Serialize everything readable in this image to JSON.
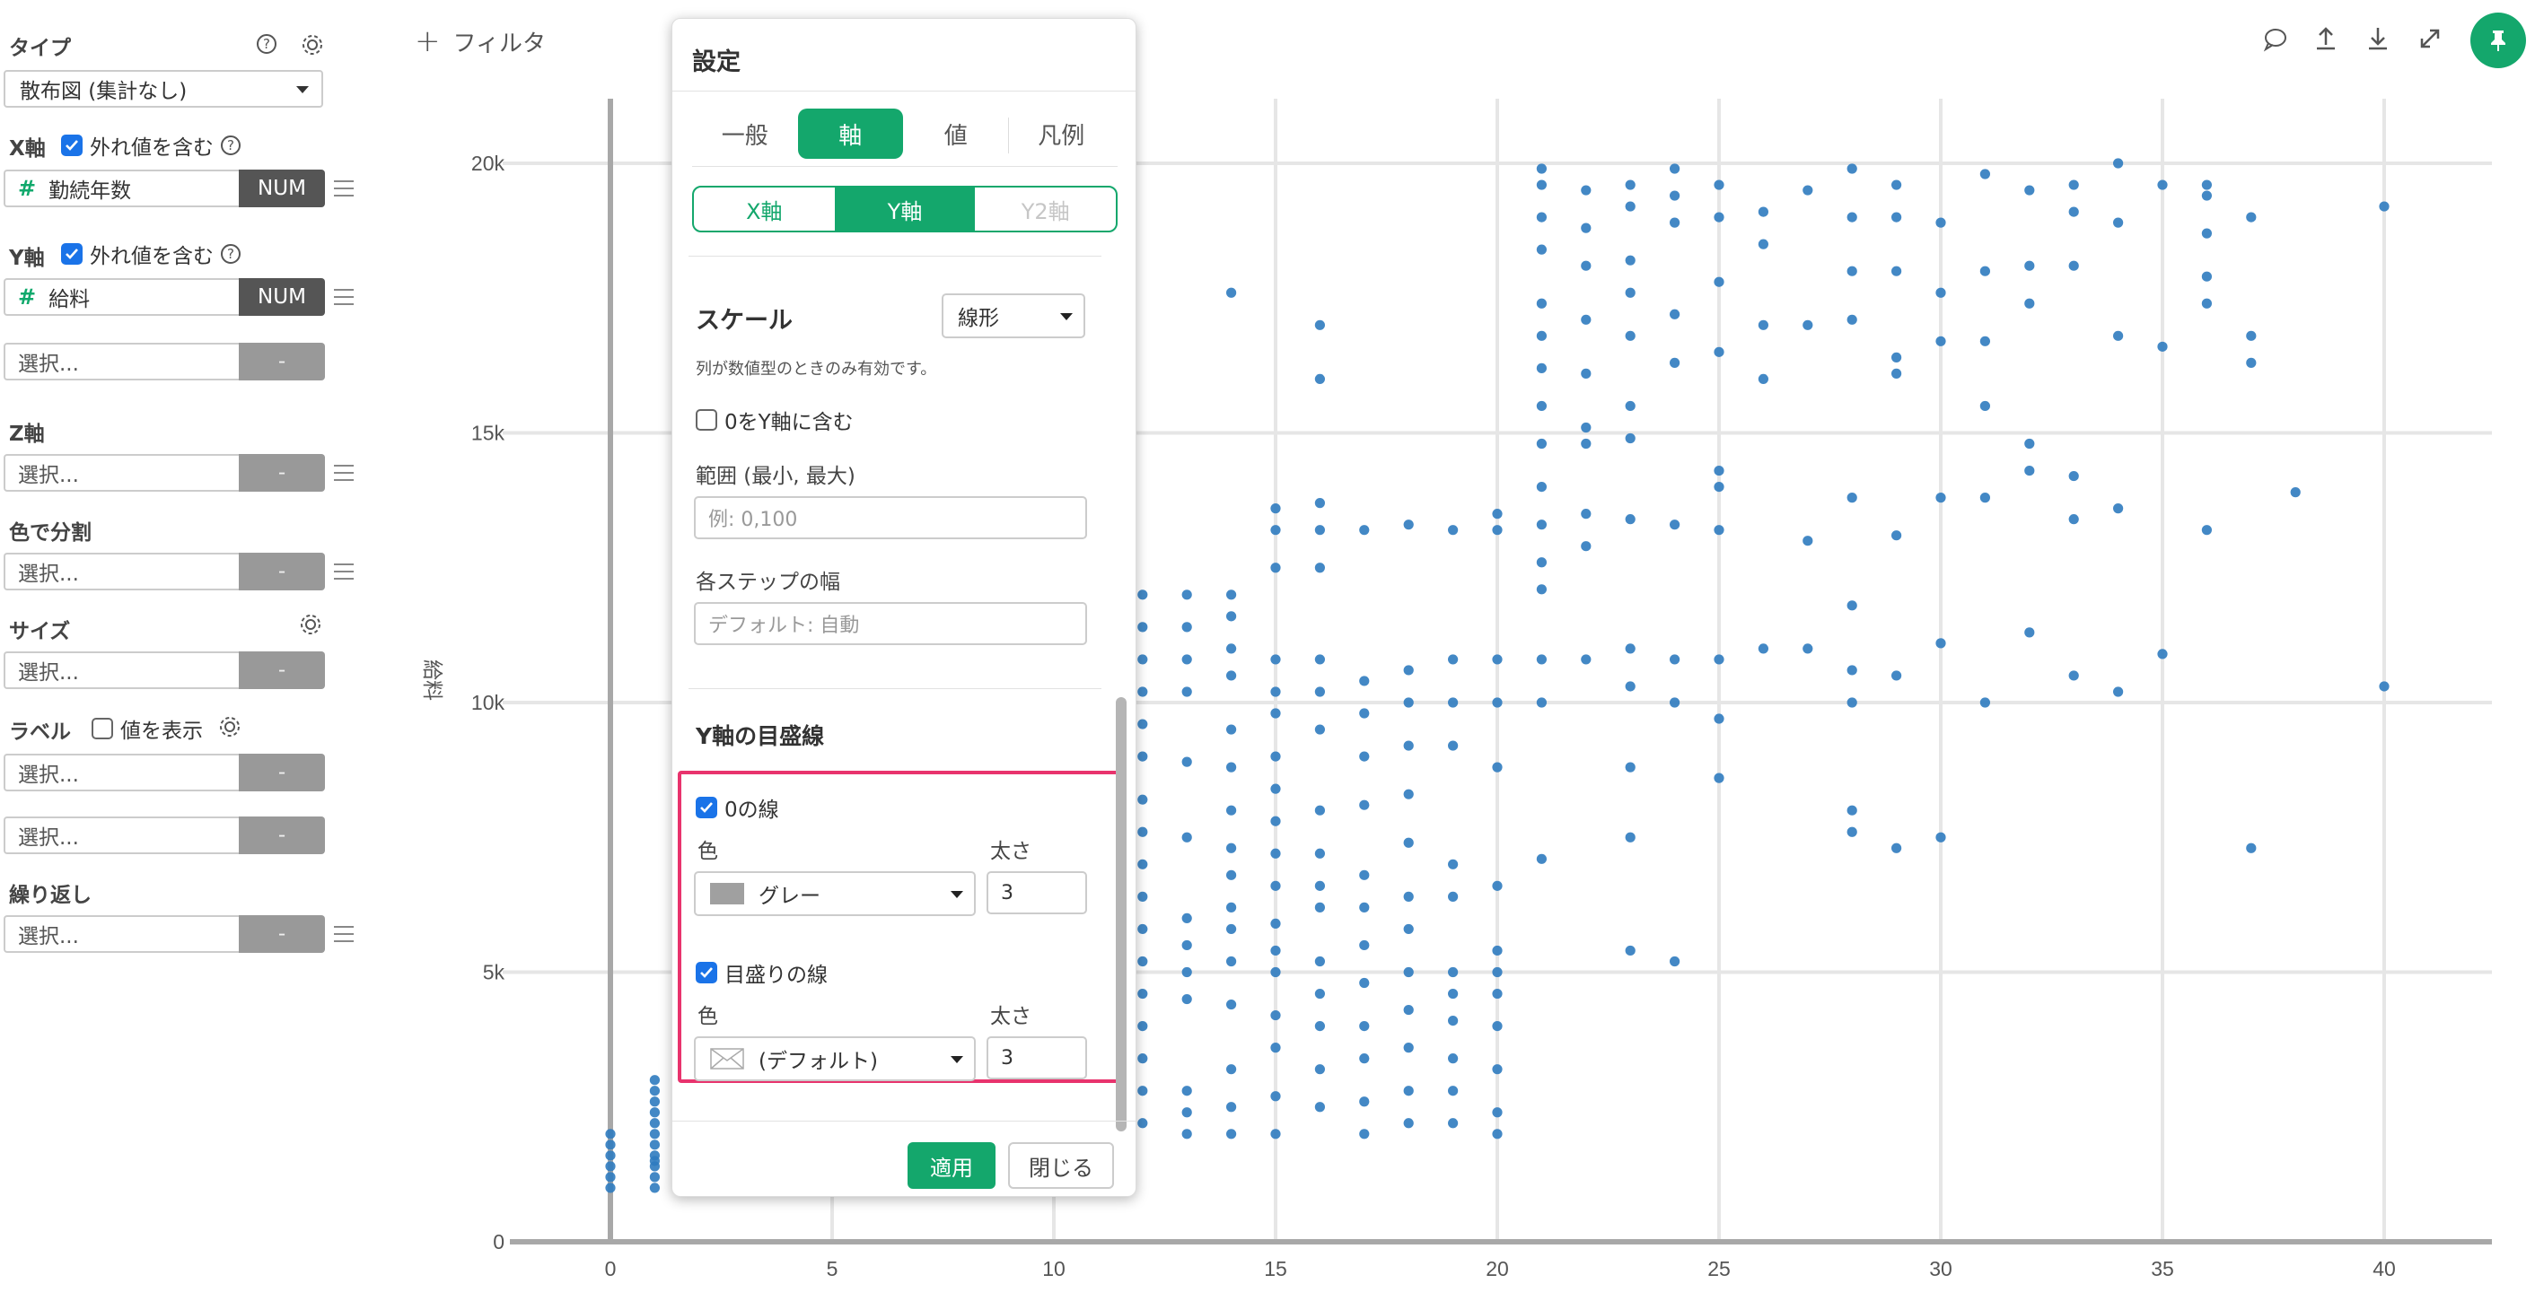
{
  "sidebar": {
    "type_label": "タイプ",
    "type_value": "散布図 (集計なし)",
    "x_axis": {
      "label": "X軸",
      "outlier_label": "外れ値を含む",
      "field": "勤続年数",
      "field_type": "NUM"
    },
    "y_axis": {
      "label": "Y軸",
      "outlier_label": "外れ値を含む",
      "field": "給料",
      "field_type": "NUM",
      "extra_placeholder": "選択...",
      "extra_tag": "-"
    },
    "z_axis": {
      "label": "Z軸",
      "placeholder": "選択...",
      "tag": "-"
    },
    "color": {
      "label": "色で分割",
      "placeholder": "選択...",
      "tag": "-"
    },
    "size": {
      "label": "サイズ",
      "placeholder": "選択...",
      "tag": "-"
    },
    "label": {
      "label": "ラベル",
      "show_values": "値を表示",
      "placeholder1": "選択...",
      "placeholder2": "選択...",
      "tag": "-"
    },
    "repeat": {
      "label": "繰り返し",
      "placeholder": "選択...",
      "tag": "-"
    }
  },
  "toolbar": {
    "filter_label": "フィルタ",
    "plus": "+"
  },
  "dialog": {
    "title": "設定",
    "tabs": [
      "一般",
      "軸",
      "値",
      "凡例"
    ],
    "active_tab": "軸",
    "axis_tabs": [
      "X軸",
      "Y軸",
      "Y2軸"
    ],
    "scale_label": "スケール",
    "scale_value": "線形",
    "scale_note": "列が数値型のときのみ有効です。",
    "include_zero_label": "0をY軸に含む",
    "range_label": "範囲 (最小, 最大)",
    "range_placeholder": "例: 0,100",
    "step_label": "各ステップの幅",
    "step_placeholder": "デフォルト: 自動",
    "gridline_section": "Y軸の目盛線",
    "zero_line": {
      "label": "0の線",
      "color_label": "色",
      "color_value": "グレー",
      "width_label": "太さ",
      "width_value": "3",
      "swatch": "#a0a0a0"
    },
    "tick_line": {
      "label": "目盛りの線",
      "color_label": "色",
      "color_value": "(デフォルト)",
      "width_label": "太さ",
      "width_value": "3"
    },
    "apply": "適用",
    "close": "閉じる"
  },
  "colors": {
    "accent": "#14a76c",
    "point": "#2f7bbf",
    "highlight": "#e8336d"
  },
  "chart_data": {
    "type": "scatter",
    "xlabel": "",
    "ylabel": "給料",
    "xlim": [
      0,
      42
    ],
    "ylim": [
      0,
      20500
    ],
    "x_ticks": [
      0,
      5,
      10,
      15,
      20,
      25,
      30,
      35,
      40
    ],
    "y_ticks": [
      0,
      5000,
      10000,
      15000,
      20000
    ],
    "y_tick_labels": [
      "0",
      "5k",
      "10k",
      "15k",
      "20k"
    ],
    "grid": true,
    "series": [
      {
        "points": [
          [
            0,
            1000
          ],
          [
            0,
            1200
          ],
          [
            0,
            1400
          ],
          [
            0,
            1600
          ],
          [
            0,
            1800
          ],
          [
            0,
            2000
          ],
          [
            1,
            1000
          ],
          [
            1,
            1200
          ],
          [
            1,
            1400
          ],
          [
            1,
            1500
          ],
          [
            1,
            1600
          ],
          [
            1,
            1800
          ],
          [
            1,
            2000
          ],
          [
            1,
            2200
          ],
          [
            1,
            2400
          ],
          [
            1,
            2600
          ],
          [
            1,
            2800
          ],
          [
            1,
            3000
          ],
          [
            12,
            2200
          ],
          [
            12,
            2800
          ],
          [
            12,
            3400
          ],
          [
            12,
            4000
          ],
          [
            12,
            4600
          ],
          [
            12,
            5200
          ],
          [
            12,
            5800
          ],
          [
            12,
            6400
          ],
          [
            12,
            7000
          ],
          [
            12,
            7600
          ],
          [
            12,
            8200
          ],
          [
            12,
            9000
          ],
          [
            12,
            9600
          ],
          [
            12,
            10200
          ],
          [
            12,
            10800
          ],
          [
            12,
            11400
          ],
          [
            12,
            12000
          ],
          [
            13,
            2000
          ],
          [
            13,
            2400
          ],
          [
            13,
            2800
          ],
          [
            13,
            4500
          ],
          [
            13,
            5000
          ],
          [
            13,
            5500
          ],
          [
            13,
            6000
          ],
          [
            13,
            7500
          ],
          [
            13,
            8900
          ],
          [
            13,
            10200
          ],
          [
            13,
            10800
          ],
          [
            13,
            11400
          ],
          [
            13,
            12000
          ],
          [
            14,
            2000
          ],
          [
            14,
            2500
          ],
          [
            14,
            3200
          ],
          [
            14,
            4400
          ],
          [
            14,
            5200
          ],
          [
            14,
            5800
          ],
          [
            14,
            6200
          ],
          [
            14,
            6800
          ],
          [
            14,
            7300
          ],
          [
            14,
            8000
          ],
          [
            14,
            8800
          ],
          [
            14,
            9500
          ],
          [
            14,
            10500
          ],
          [
            14,
            11000
          ],
          [
            14,
            11600
          ],
          [
            14,
            12000
          ],
          [
            14,
            17600
          ],
          [
            15,
            2000
          ],
          [
            15,
            2700
          ],
          [
            15,
            3600
          ],
          [
            15,
            4200
          ],
          [
            15,
            5000
          ],
          [
            15,
            5400
          ],
          [
            15,
            5900
          ],
          [
            15,
            6600
          ],
          [
            15,
            7200
          ],
          [
            15,
            7800
          ],
          [
            15,
            8400
          ],
          [
            15,
            9000
          ],
          [
            15,
            9800
          ],
          [
            15,
            10200
          ],
          [
            15,
            10800
          ],
          [
            15,
            12500
          ],
          [
            15,
            13200
          ],
          [
            15,
            13600
          ],
          [
            16,
            2500
          ],
          [
            16,
            3200
          ],
          [
            16,
            4000
          ],
          [
            16,
            4600
          ],
          [
            16,
            5200
          ],
          [
            16,
            6200
          ],
          [
            16,
            6600
          ],
          [
            16,
            7200
          ],
          [
            16,
            8000
          ],
          [
            16,
            9500
          ],
          [
            16,
            10200
          ],
          [
            16,
            10800
          ],
          [
            16,
            12500
          ],
          [
            16,
            13200
          ],
          [
            16,
            13700
          ],
          [
            16,
            16000
          ],
          [
            16,
            17000
          ],
          [
            17,
            2000
          ],
          [
            17,
            2600
          ],
          [
            17,
            3400
          ],
          [
            17,
            4000
          ],
          [
            17,
            4800
          ],
          [
            17,
            5500
          ],
          [
            17,
            6200
          ],
          [
            17,
            6800
          ],
          [
            17,
            8100
          ],
          [
            17,
            9000
          ],
          [
            17,
            9800
          ],
          [
            17,
            10400
          ],
          [
            17,
            13200
          ],
          [
            18,
            2200
          ],
          [
            18,
            2800
          ],
          [
            18,
            3600
          ],
          [
            18,
            4300
          ],
          [
            18,
            5000
          ],
          [
            18,
            5800
          ],
          [
            18,
            6400
          ],
          [
            18,
            7400
          ],
          [
            18,
            8300
          ],
          [
            18,
            9200
          ],
          [
            18,
            10000
          ],
          [
            18,
            10600
          ],
          [
            18,
            13300
          ],
          [
            19,
            2200
          ],
          [
            19,
            2800
          ],
          [
            19,
            3400
          ],
          [
            19,
            4100
          ],
          [
            19,
            4600
          ],
          [
            19,
            5000
          ],
          [
            19,
            6400
          ],
          [
            19,
            7000
          ],
          [
            19,
            9200
          ],
          [
            19,
            10000
          ],
          [
            19,
            10800
          ],
          [
            19,
            13200
          ],
          [
            20,
            2000
          ],
          [
            20,
            2400
          ],
          [
            20,
            3200
          ],
          [
            20,
            4000
          ],
          [
            20,
            4600
          ],
          [
            20,
            5000
          ],
          [
            20,
            5400
          ],
          [
            20,
            6600
          ],
          [
            20,
            8800
          ],
          [
            20,
            10000
          ],
          [
            20,
            10800
          ],
          [
            20,
            13200
          ],
          [
            20,
            13500
          ],
          [
            21,
            7100
          ],
          [
            21,
            10000
          ],
          [
            21,
            10800
          ],
          [
            21,
            12100
          ],
          [
            21,
            12600
          ],
          [
            21,
            13300
          ],
          [
            21,
            14000
          ],
          [
            21,
            14800
          ],
          [
            21,
            15500
          ],
          [
            21,
            16200
          ],
          [
            21,
            16800
          ],
          [
            21,
            17400
          ],
          [
            21,
            18400
          ],
          [
            21,
            19000
          ],
          [
            21,
            19600
          ],
          [
            21,
            19900
          ],
          [
            22,
            10800
          ],
          [
            22,
            12900
          ],
          [
            22,
            13500
          ],
          [
            22,
            14800
          ],
          [
            22,
            15100
          ],
          [
            22,
            16100
          ],
          [
            22,
            17100
          ],
          [
            22,
            18100
          ],
          [
            22,
            18800
          ],
          [
            22,
            19500
          ],
          [
            23,
            5400
          ],
          [
            23,
            7500
          ],
          [
            23,
            8800
          ],
          [
            23,
            10300
          ],
          [
            23,
            11000
          ],
          [
            23,
            13400
          ],
          [
            23,
            14900
          ],
          [
            23,
            15500
          ],
          [
            23,
            16800
          ],
          [
            23,
            17600
          ],
          [
            23,
            18200
          ],
          [
            23,
            19200
          ],
          [
            23,
            19600
          ],
          [
            24,
            5200
          ],
          [
            24,
            10000
          ],
          [
            24,
            10800
          ],
          [
            24,
            13300
          ],
          [
            24,
            16300
          ],
          [
            24,
            17200
          ],
          [
            24,
            18900
          ],
          [
            24,
            19400
          ],
          [
            24,
            19900
          ],
          [
            25,
            8600
          ],
          [
            25,
            9700
          ],
          [
            25,
            10800
          ],
          [
            25,
            13200
          ],
          [
            25,
            14000
          ],
          [
            25,
            14300
          ],
          [
            25,
            16500
          ],
          [
            25,
            17800
          ],
          [
            25,
            19000
          ],
          [
            25,
            19600
          ],
          [
            26,
            11000
          ],
          [
            26,
            16000
          ],
          [
            26,
            17000
          ],
          [
            26,
            18500
          ],
          [
            26,
            19100
          ],
          [
            27,
            11000
          ],
          [
            27,
            13000
          ],
          [
            27,
            17000
          ],
          [
            27,
            19500
          ],
          [
            28,
            7600
          ],
          [
            28,
            8000
          ],
          [
            28,
            10000
          ],
          [
            28,
            10600
          ],
          [
            28,
            11800
          ],
          [
            28,
            13800
          ],
          [
            28,
            17100
          ],
          [
            28,
            18000
          ],
          [
            28,
            19000
          ],
          [
            28,
            19900
          ],
          [
            29,
            7300
          ],
          [
            29,
            10500
          ],
          [
            29,
            13100
          ],
          [
            29,
            16100
          ],
          [
            29,
            16400
          ],
          [
            29,
            18000
          ],
          [
            29,
            19000
          ],
          [
            29,
            19600
          ],
          [
            30,
            7500
          ],
          [
            30,
            11100
          ],
          [
            30,
            13800
          ],
          [
            30,
            16700
          ],
          [
            30,
            17600
          ],
          [
            30,
            18900
          ],
          [
            31,
            10000
          ],
          [
            31,
            13800
          ],
          [
            31,
            15500
          ],
          [
            31,
            16700
          ],
          [
            31,
            18000
          ],
          [
            31,
            19800
          ],
          [
            32,
            11300
          ],
          [
            32,
            14300
          ],
          [
            32,
            14800
          ],
          [
            32,
            17400
          ],
          [
            32,
            18100
          ],
          [
            32,
            19500
          ],
          [
            33,
            10500
          ],
          [
            33,
            13400
          ],
          [
            33,
            14200
          ],
          [
            33,
            18100
          ],
          [
            33,
            19100
          ],
          [
            33,
            19600
          ],
          [
            34,
            10200
          ],
          [
            34,
            13600
          ],
          [
            34,
            16800
          ],
          [
            34,
            18900
          ],
          [
            34,
            20000
          ],
          [
            35,
            10900
          ],
          [
            35,
            16600
          ],
          [
            35,
            19600
          ],
          [
            36,
            13200
          ],
          [
            36,
            17400
          ],
          [
            36,
            17900
          ],
          [
            36,
            18700
          ],
          [
            36,
            19400
          ],
          [
            36,
            19600
          ],
          [
            37,
            7300
          ],
          [
            37,
            16300
          ],
          [
            37,
            16800
          ],
          [
            37,
            19000
          ],
          [
            38,
            13900
          ],
          [
            40,
            10300
          ],
          [
            40,
            19200
          ]
        ]
      }
    ]
  }
}
